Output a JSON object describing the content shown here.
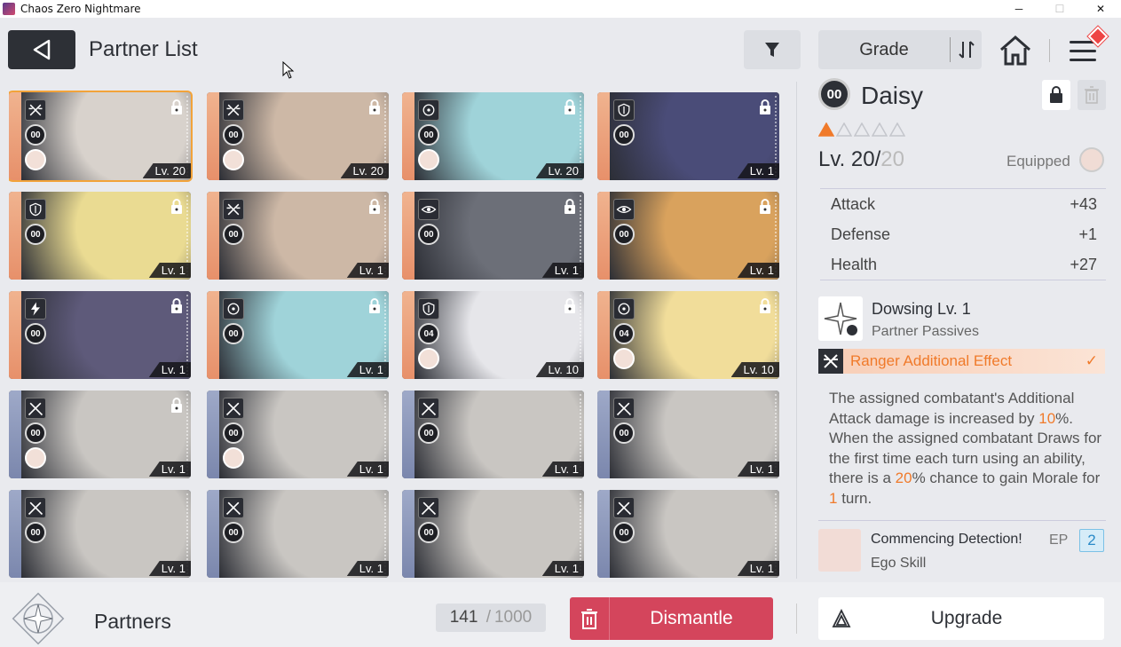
{
  "window": {
    "title": "Chaos Zero Nightmare",
    "minimize": "─",
    "maximize": "☐",
    "close": "✕"
  },
  "header": {
    "title": "Partner List",
    "sort_label": "Grade"
  },
  "cards": [
    {
      "grade": "00",
      "level": "Lv. 20",
      "class_icon": "ranger-icon",
      "locked": true,
      "selected": true,
      "strip": "orange",
      "has_avatar": true,
      "bg": "#d8d2cc"
    },
    {
      "grade": "00",
      "level": "Lv. 20",
      "class_icon": "ranger-icon",
      "locked": true,
      "strip": "orange",
      "has_avatar": true,
      "bg": "#cdb8a6"
    },
    {
      "grade": "00",
      "level": "Lv. 20",
      "class_icon": "target-icon",
      "locked": true,
      "strip": "orange",
      "has_avatar": true,
      "bg": "#9fd3d9"
    },
    {
      "grade": "00",
      "level": "Lv. 1",
      "class_icon": "shield-icon",
      "locked": true,
      "strip": "orange",
      "has_avatar": false,
      "bg": "#4a4c78"
    },
    {
      "grade": "00",
      "level": "Lv. 1",
      "class_icon": "shield-icon",
      "locked": true,
      "strip": "orange",
      "has_avatar": false,
      "bg": "#eadb92"
    },
    {
      "grade": "00",
      "level": "Lv. 1",
      "class_icon": "ranger-icon",
      "locked": true,
      "strip": "orange",
      "has_avatar": false,
      "bg": "#cdb8a6"
    },
    {
      "grade": "00",
      "level": "Lv. 1",
      "class_icon": "eye-icon",
      "locked": true,
      "strip": "orange",
      "has_avatar": false,
      "bg": "#6c6f78"
    },
    {
      "grade": "00",
      "level": "Lv. 1",
      "class_icon": "eye-icon",
      "locked": true,
      "strip": "orange",
      "has_avatar": false,
      "bg": "#d9a25d"
    },
    {
      "grade": "00",
      "level": "Lv. 1",
      "class_icon": "lightning-icon",
      "locked": true,
      "strip": "orange",
      "has_avatar": false,
      "bg": "#5e5a7a"
    },
    {
      "grade": "00",
      "level": "Lv. 1",
      "class_icon": "target-icon",
      "locked": true,
      "strip": "orange",
      "has_avatar": false,
      "bg": "#9fd3d9"
    },
    {
      "grade": "04",
      "level": "Lv. 10",
      "class_icon": "shield-icon",
      "locked": true,
      "strip": "orange",
      "has_avatar": true,
      "bg": "#e6e6ea"
    },
    {
      "grade": "04",
      "level": "Lv. 10",
      "class_icon": "target-icon",
      "locked": true,
      "strip": "orange",
      "has_avatar": true,
      "bg": "#f1dd9a"
    },
    {
      "grade": "00",
      "level": "Lv. 1",
      "class_icon": "swords-icon",
      "locked": true,
      "strip": "blue",
      "has_avatar": true,
      "bg": "#c9c6c2"
    },
    {
      "grade": "00",
      "level": "Lv. 1",
      "class_icon": "swords-icon",
      "locked": false,
      "strip": "blue",
      "has_avatar": true,
      "bg": "#c9c6c2"
    },
    {
      "grade": "00",
      "level": "Lv. 1",
      "class_icon": "swords-icon",
      "locked": false,
      "strip": "blue",
      "has_avatar": false,
      "bg": "#c9c6c2"
    },
    {
      "grade": "00",
      "level": "Lv. 1",
      "class_icon": "swords-icon",
      "locked": false,
      "strip": "blue",
      "has_avatar": false,
      "bg": "#c9c6c2"
    },
    {
      "grade": "00",
      "level": "Lv. 1",
      "class_icon": "swords-icon",
      "locked": false,
      "strip": "blue",
      "has_avatar": false,
      "bg": "#c9c6c2"
    },
    {
      "grade": "00",
      "level": "Lv. 1",
      "class_icon": "swords-icon",
      "locked": false,
      "strip": "blue",
      "has_avatar": false,
      "bg": "#c9c6c2"
    },
    {
      "grade": "00",
      "level": "Lv. 1",
      "class_icon": "swords-icon",
      "locked": false,
      "strip": "blue",
      "has_avatar": false,
      "bg": "#c9c6c2"
    },
    {
      "grade": "00",
      "level": "Lv. 1",
      "class_icon": "swords-icon",
      "locked": false,
      "strip": "blue",
      "has_avatar": false,
      "bg": "#c9c6c2"
    }
  ],
  "detail": {
    "grade": "00",
    "name": "Daisy",
    "stars_filled": 1,
    "stars_total": 5,
    "level_current": "Lv. 20/",
    "level_max": "20",
    "equipped_label": "Equipped",
    "stats": [
      {
        "label": "Attack",
        "value": "+43"
      },
      {
        "label": "Defense",
        "value": "+1"
      },
      {
        "label": "Health",
        "value": "+27"
      }
    ],
    "passive_title": "Dowsing Lv. 1",
    "passive_sub": "Partner Passives",
    "effect_title": "Ranger Additional Effect",
    "effect_check": "✓",
    "desc_1": "The assigned combatant's Additional Attack damage is increased by ",
    "desc_pct1": "10",
    "desc_2": "%. When the assigned combatant Draws for the first time each turn using an ability, there is a ",
    "desc_pct2": "20",
    "desc_3": "% chance to gain Morale for ",
    "desc_turns": "1",
    "desc_4": " turn.",
    "ego_title": "Commencing Detection!",
    "ego_sub": "Ego Skill",
    "ep_label": "EP",
    "ep_value": "2"
  },
  "bottom": {
    "label": "Partners",
    "count": "141",
    "count_sep": "/",
    "count_total": "1000",
    "dismantle": "Dismantle",
    "upgrade": "Upgrade"
  },
  "colors": {
    "accent_orange": "#f07a2a",
    "dismantle_red": "#d4455c",
    "selected_outline": "#f2a33a"
  }
}
